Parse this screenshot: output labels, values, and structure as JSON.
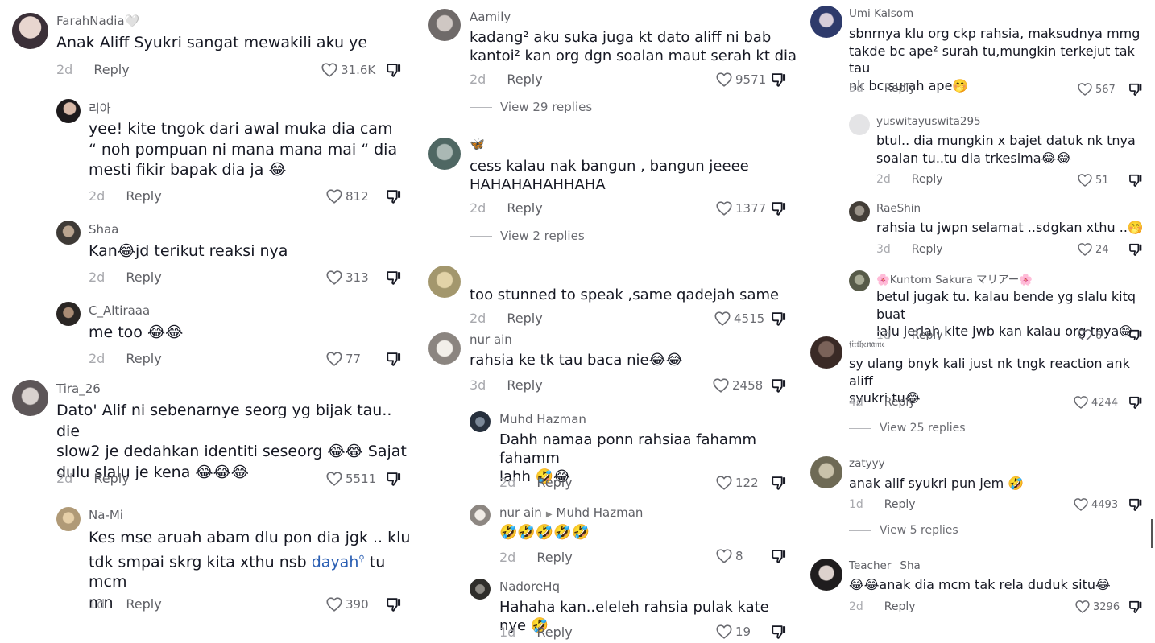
{
  "col1": [
    {
      "user": "FarahNadia🤍",
      "text": "Anak Aliff Syukri sangat mewakili aku ye",
      "time": "2d",
      "reply": "Reply",
      "likes": "31.6K"
    },
    {
      "user": "리아",
      "text": "yee! kite tngok dari awal muka dia cam\n“ noh pompuan ni mana mana mai “ dia\nmesti fikir bapak dia ja 😂",
      "time": "2d",
      "reply": "Reply",
      "likes": "812"
    },
    {
      "user": "Shaa",
      "text": "Kan😂jd terikut reaksi nya",
      "time": "2d",
      "reply": "Reply",
      "likes": "313"
    },
    {
      "user": "C_Altiraaa",
      "text": "me too 😂😂",
      "time": "2d",
      "reply": "Reply",
      "likes": "77"
    },
    {
      "user": "Tira_26",
      "text": "Dato' Alif ni sebenarnye seorg yg bijak tau.. die\nslow2 je dedahkan identiti seseorg 😂😂 Sajat\ndulu slalu je kena 😂😂😂",
      "time": "2d",
      "reply": "Reply",
      "likes": "5511"
    },
    {
      "user": "Na-Mi",
      "text_before": "Kes mse aruah abam dlu pon dia jgk .. klu\ntdk smpai skrg kita xthu nsb ",
      "mention": "dayah",
      "text_after": " tu mcm\nmn",
      "time": "1d",
      "reply": "Reply",
      "likes": "390"
    }
  ],
  "col2": [
    {
      "user": "Aamily",
      "text": "kadang² aku suka juga kt dato aliff ni bab\nkantoi² kan org dgn soalan maut serah kt dia",
      "time": "2d",
      "reply": "Reply",
      "likes": "9571",
      "view": "View 29 replies"
    },
    {
      "user": "🦋",
      "text": "cess kalau nak bangun , bangun jeeee\nHAHAHAHAHHAHA",
      "time": "2d",
      "reply": "Reply",
      "likes": "1377",
      "view": "View 2 replies"
    },
    {
      "user": "",
      "text": "too stunned to speak ,same qadejah same",
      "time": "2d",
      "reply": "Reply",
      "likes": "4515"
    },
    {
      "user": "nur ain",
      "text": "rahsia ke tk tau baca nie😂😂",
      "time": "3d",
      "reply": "Reply",
      "likes": "2458"
    },
    {
      "user": "Muhd Hazman",
      "text": "Dahh namaa ponn rahsiaa fahamm fahamm\nlahh 🤣😂",
      "time": "2d",
      "reply": "Reply",
      "likes": "122"
    },
    {
      "user": "nur ain",
      "reply_to": "Muhd Hazman",
      "text": "🤣🤣🤣🤣🤣",
      "time": "2d",
      "reply": "Reply",
      "likes": "8"
    },
    {
      "user": "NadoreHq",
      "text": "Hahaha kan..eleleh rahsia pulak kate nye 🤣",
      "time": "1d",
      "reply": "Reply",
      "likes": "19"
    }
  ],
  "col3": [
    {
      "user": "Umi Kalsom",
      "text": "sbnrnya klu org ckp rahsia, maksudnya mmg\ntakde bc ape² surah tu,mungkin terkejut tak tau\nnk bc surah ape🤭",
      "time": "3d",
      "reply": "Reply",
      "likes": "567"
    },
    {
      "user": "yuswitayuswita295",
      "text": "btul.. dia mungkin x bajet datuk nk tnya\nsoalan tu..tu dia trkesima😂😂",
      "time": "2d",
      "reply": "Reply",
      "likes": "51"
    },
    {
      "user": "RaeShin",
      "text": "rahsia tu jwpn selamat ..sdgkan xthu ..🤭",
      "time": "3d",
      "reply": "Reply",
      "likes": "24"
    },
    {
      "user": "🌸Kuntom Sakura マリアー🌸",
      "text": "betul jugak tu. kalau bende yg slalu kitq buat\nlaju jerlah kite jwb kan kalau org tnya😁",
      "time": "1d",
      "reply": "Reply",
      "likes": "6"
    },
    {
      "user": "𝔣𝔦𝔱𝔱𝔥𝔢𝔫𝔞𝔪𝔢",
      "text": "sy ulang bnyk kali just nk tngk reaction ank aliff\nsyukri tu😂",
      "time": "4d",
      "reply": "Reply",
      "likes": "4244",
      "view": "View 25 replies"
    },
    {
      "user": "zatyyy",
      "text": "anak alif syukri pun jem 🤣",
      "time": "1d",
      "reply": "Reply",
      "likes": "4493",
      "view": "View 5 replies"
    },
    {
      "user": "Teacher _Sha",
      "text": "😂😂anak dia mcm tak rela duduk situ😂",
      "time": "2d",
      "reply": "Reply",
      "likes": "3296"
    }
  ],
  "icons": {
    "like": "heart-outline-icon",
    "dislike": "thumbs-down-icon"
  }
}
